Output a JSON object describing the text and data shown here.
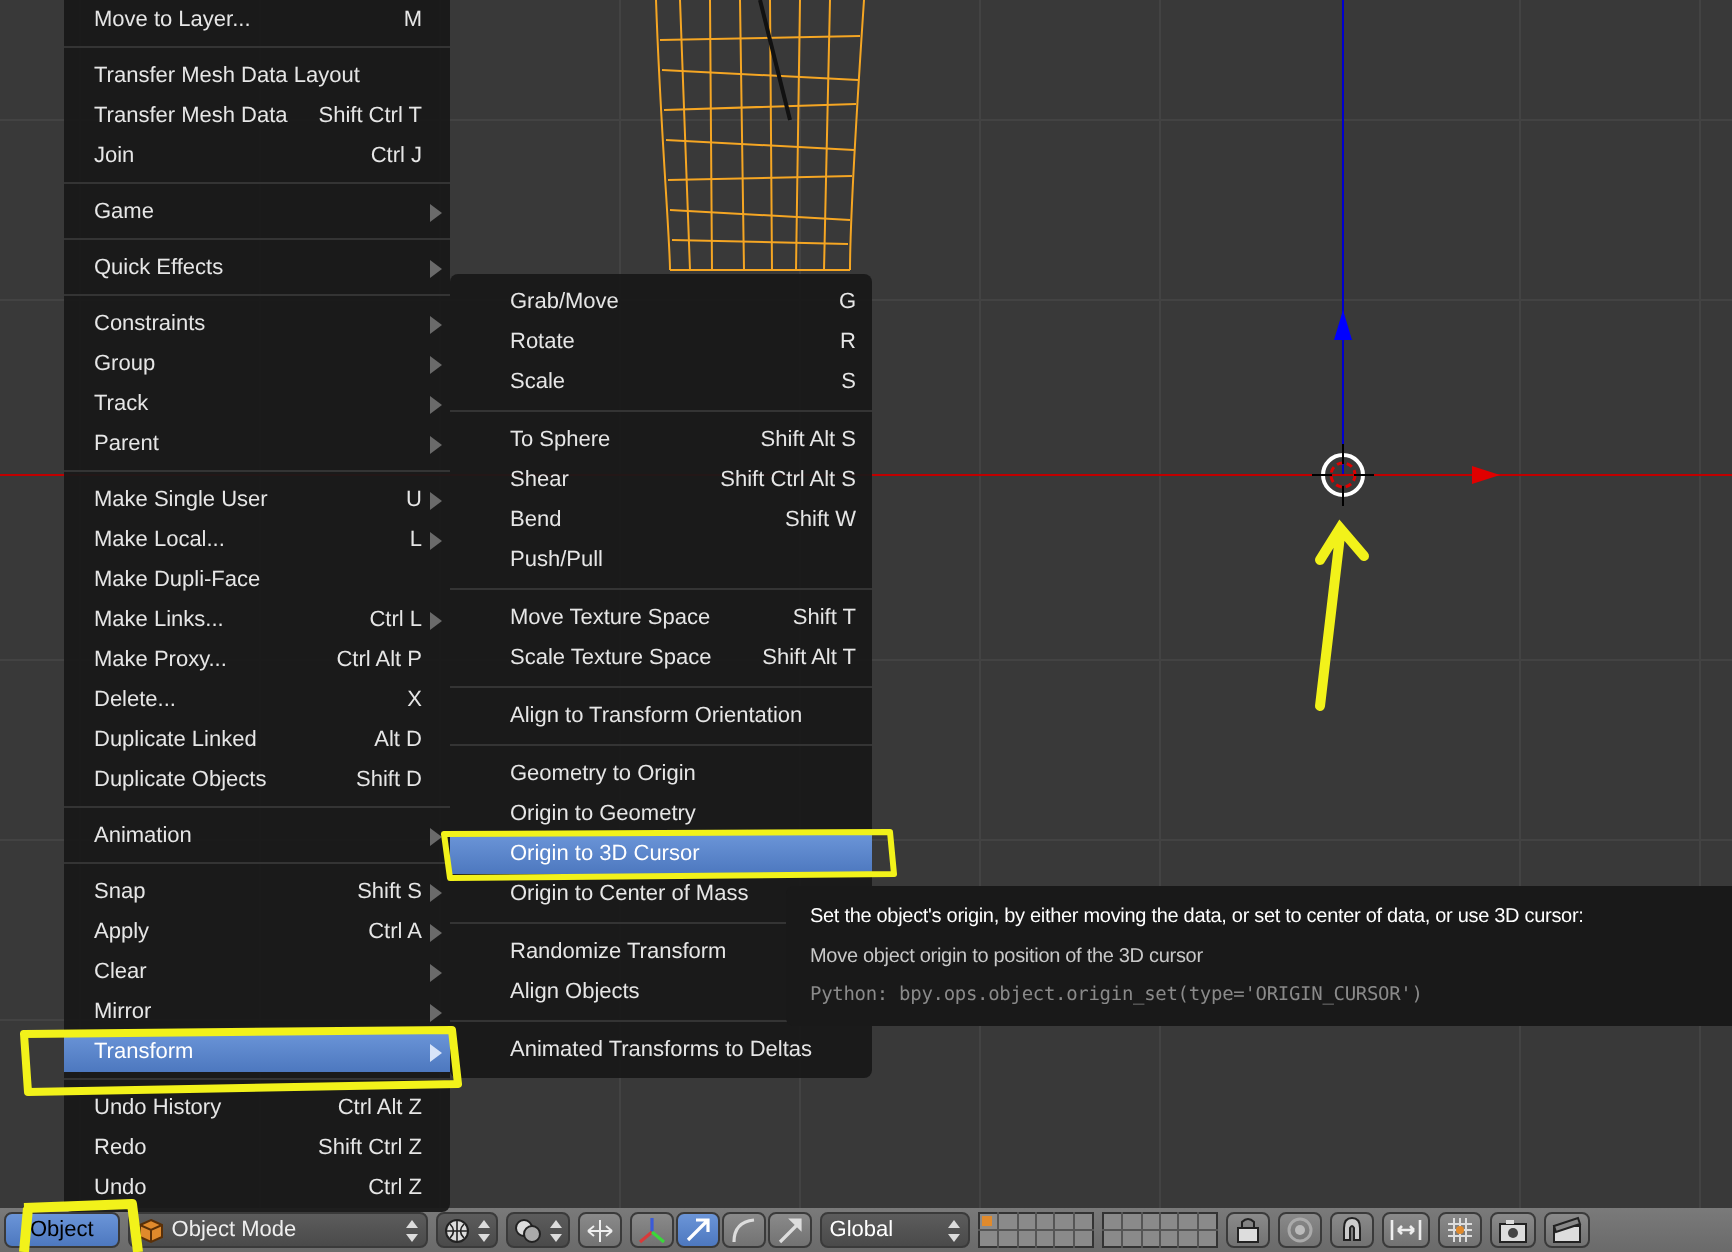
{
  "main_menu": {
    "sections": [
      {
        "items": [
          {
            "label": "Move to Layer...",
            "shortcut": "M",
            "submenu": false,
            "selected": false
          }
        ]
      },
      {
        "items": [
          {
            "label": "Transfer Mesh Data Layout",
            "submenu": false,
            "selected": false
          },
          {
            "label": "Transfer Mesh Data",
            "shortcut": "Shift Ctrl T",
            "submenu": false,
            "selected": false
          },
          {
            "label": "Join",
            "shortcut": "Ctrl J",
            "submenu": false,
            "selected": false
          }
        ]
      },
      {
        "items": [
          {
            "label": "Game",
            "submenu": true,
            "selected": false
          }
        ]
      },
      {
        "items": [
          {
            "label": "Quick Effects",
            "submenu": true,
            "selected": false
          }
        ]
      },
      {
        "items": [
          {
            "label": "Constraints",
            "submenu": true,
            "selected": false
          },
          {
            "label": "Group",
            "submenu": true,
            "selected": false
          },
          {
            "label": "Track",
            "submenu": true,
            "selected": false
          },
          {
            "label": "Parent",
            "submenu": true,
            "selected": false
          }
        ]
      },
      {
        "items": [
          {
            "label": "Make Single User",
            "shortcut": "U",
            "submenu": true,
            "selected": false
          },
          {
            "label": "Make Local...",
            "shortcut": "L",
            "submenu": true,
            "selected": false
          },
          {
            "label": "Make Dupli-Face",
            "submenu": false,
            "selected": false
          },
          {
            "label": "Make Links...",
            "shortcut": "Ctrl L",
            "submenu": true,
            "selected": false
          },
          {
            "label": "Make Proxy...",
            "shortcut": "Ctrl Alt P",
            "submenu": false,
            "selected": false
          },
          {
            "label": "Delete...",
            "shortcut": "X",
            "submenu": false,
            "selected": false
          },
          {
            "label": "Duplicate Linked",
            "shortcut": "Alt D",
            "submenu": false,
            "selected": false
          },
          {
            "label": "Duplicate Objects",
            "shortcut": "Shift D",
            "submenu": false,
            "selected": false
          }
        ]
      },
      {
        "items": [
          {
            "label": "Animation",
            "submenu": true,
            "selected": false
          }
        ]
      },
      {
        "items": [
          {
            "label": "Snap",
            "shortcut": "Shift S",
            "submenu": true,
            "selected": false
          },
          {
            "label": "Apply",
            "shortcut": "Ctrl A",
            "submenu": true,
            "selected": false
          },
          {
            "label": "Clear",
            "submenu": true,
            "selected": false
          },
          {
            "label": "Mirror",
            "submenu": true,
            "selected": false
          },
          {
            "label": "Transform",
            "submenu": true,
            "selected": true
          }
        ]
      },
      {
        "items": [
          {
            "label": "Undo History",
            "shortcut": "Ctrl Alt Z",
            "submenu": false,
            "selected": false
          },
          {
            "label": "Redo",
            "shortcut": "Shift Ctrl Z",
            "submenu": false,
            "selected": false
          },
          {
            "label": "Undo",
            "shortcut": "Ctrl Z",
            "submenu": false,
            "selected": false
          }
        ]
      }
    ]
  },
  "transform_menu": {
    "sections": [
      {
        "items": [
          {
            "label": "Grab/Move",
            "shortcut": "G",
            "selected": false
          },
          {
            "label": "Rotate",
            "shortcut": "R",
            "selected": false
          },
          {
            "label": "Scale",
            "shortcut": "S",
            "selected": false
          }
        ]
      },
      {
        "items": [
          {
            "label": "To Sphere",
            "shortcut": "Shift Alt S",
            "selected": false
          },
          {
            "label": "Shear",
            "shortcut": "Shift Ctrl Alt S",
            "selected": false
          },
          {
            "label": "Bend",
            "shortcut": "Shift W",
            "selected": false
          },
          {
            "label": "Push/Pull",
            "selected": false
          }
        ]
      },
      {
        "items": [
          {
            "label": "Move Texture Space",
            "shortcut": "Shift T",
            "selected": false
          },
          {
            "label": "Scale Texture Space",
            "shortcut": "Shift Alt T",
            "selected": false
          }
        ]
      },
      {
        "items": [
          {
            "label": "Align to Transform Orientation",
            "selected": false
          }
        ]
      },
      {
        "items": [
          {
            "label": "Geometry to Origin",
            "selected": false
          },
          {
            "label": "Origin to Geometry",
            "selected": false
          },
          {
            "label": "Origin to 3D Cursor",
            "selected": true
          },
          {
            "label": "Origin to Center of Mass",
            "selected": false
          }
        ]
      },
      {
        "items": [
          {
            "label": "Randomize Transform",
            "selected": false
          },
          {
            "label": "Align Objects",
            "selected": false
          }
        ]
      },
      {
        "items": [
          {
            "label": "Animated Transforms to Deltas",
            "selected": false
          }
        ]
      }
    ]
  },
  "tooltip": {
    "description": "Set the object's origin, by either moving the data, or set to center of data, or use 3D cursor:",
    "detail": "Move object origin to position of the 3D cursor",
    "python": "Python: bpy.ops.object.origin_set(type='ORIGIN_CURSOR')"
  },
  "header": {
    "menu_button": "Object",
    "mode": "Object Mode",
    "orientation": "Global"
  }
}
